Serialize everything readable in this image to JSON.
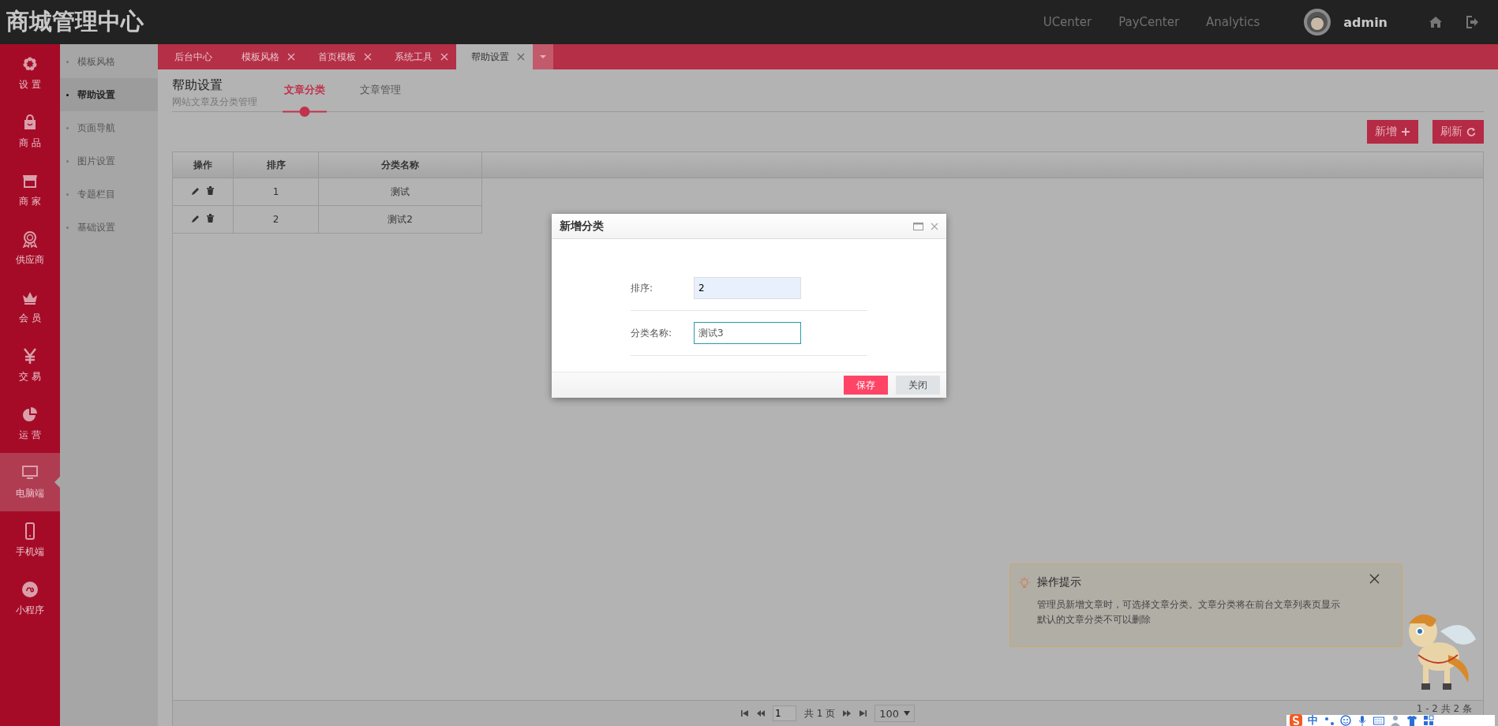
{
  "header": {
    "logo": "商城管理中心",
    "links": [
      "UCenter",
      "PayCenter",
      "Analytics"
    ],
    "user": "admin"
  },
  "main_nav": [
    {
      "label": "设 置",
      "selected": false
    },
    {
      "label": "商 品",
      "selected": false
    },
    {
      "label": "商 家",
      "selected": false
    },
    {
      "label": "供应商",
      "selected": false
    },
    {
      "label": "会 员",
      "selected": false
    },
    {
      "label": "交 易",
      "selected": false
    },
    {
      "label": "运 营",
      "selected": false
    },
    {
      "label": "电脑端",
      "selected": true
    },
    {
      "label": "手机端",
      "selected": false
    },
    {
      "label": "小程序",
      "selected": false
    }
  ],
  "sub_nav": [
    {
      "label": "模板风格",
      "selected": false
    },
    {
      "label": "帮助设置",
      "selected": true
    },
    {
      "label": "页面导航",
      "selected": false
    },
    {
      "label": "图片设置",
      "selected": false
    },
    {
      "label": "专题栏目",
      "selected": false
    },
    {
      "label": "基础设置",
      "selected": false
    }
  ],
  "tabs": [
    {
      "label": "后台中心",
      "closable": false,
      "selected": false
    },
    {
      "label": "模板风格",
      "closable": true,
      "selected": false
    },
    {
      "label": "首页模板",
      "closable": true,
      "selected": false
    },
    {
      "label": "系统工具",
      "closable": true,
      "selected": false
    },
    {
      "label": "帮助设置",
      "closable": true,
      "selected": true
    }
  ],
  "page": {
    "title": "帮助设置",
    "subtitle": "网站文章及分类管理",
    "subtabs": [
      {
        "label": "文章分类",
        "selected": true
      },
      {
        "label": "文章管理",
        "selected": false
      }
    ]
  },
  "toolbar": [
    {
      "label": "新增"
    },
    {
      "label": "刷新"
    }
  ],
  "table": {
    "columns": [
      "操作",
      "排序",
      "分类名称"
    ],
    "rows": [
      {
        "order": "1",
        "name": "测试"
      },
      {
        "order": "2",
        "name": "测试2"
      }
    ]
  },
  "pagination": {
    "page": "1",
    "total_pages": "共 1 页",
    "page_size": "100",
    "summary": "1 - 2 共 2 条"
  },
  "dialog": {
    "title": "新增分类",
    "fields": [
      {
        "label": "排序:",
        "value": "2",
        "focused": false
      },
      {
        "label": "分类名称:",
        "value": "测试3",
        "focused": true
      }
    ],
    "buttons": [
      {
        "label": "保存",
        "kind": "primary"
      },
      {
        "label": "关闭",
        "kind": "secondary"
      }
    ]
  },
  "tip": {
    "title": "操作提示",
    "lines": [
      "管理员新增文章时，可选择文章分类。文章分类将在前台文章列表页显示",
      "默认的文章分类不可以删除"
    ]
  },
  "ime": {
    "mode": "中"
  }
}
